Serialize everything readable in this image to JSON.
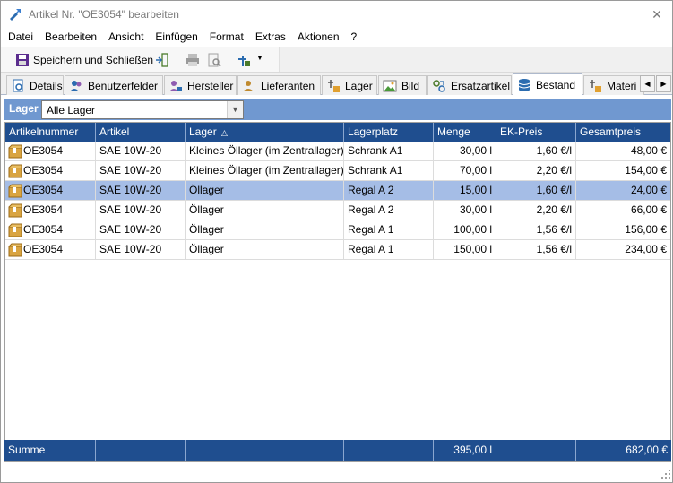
{
  "window": {
    "title": "Artikel Nr. \"OE3054\" bearbeiten",
    "close_icon": "close-icon"
  },
  "menu": [
    "Datei",
    "Bearbeiten",
    "Ansicht",
    "Einfügen",
    "Format",
    "Extras",
    "Aktionen",
    "?"
  ],
  "toolbar": {
    "save_label": "Speichern und Schließen"
  },
  "tabs": [
    {
      "label": "Details",
      "icon": "details-icon"
    },
    {
      "label": "Benutzerfelder",
      "icon": "users-icon"
    },
    {
      "label": "Hersteller",
      "icon": "manufacturer-icon"
    },
    {
      "label": "Lieferanten",
      "icon": "supplier-icon"
    },
    {
      "label": "Lager",
      "icon": "warehouse-icon"
    },
    {
      "label": "Bild",
      "icon": "image-icon"
    },
    {
      "label": "Ersatzartikel",
      "icon": "replacement-icon"
    },
    {
      "label": "Bestand",
      "icon": "stock-icon",
      "active": true
    },
    {
      "label": "Materi",
      "icon": "material-icon"
    }
  ],
  "filter": {
    "label": "Lager",
    "value": "Alle Lager"
  },
  "table": {
    "columns": [
      "Artikelnummer",
      "Artikel",
      "Lager",
      "Lagerplatz",
      "Menge",
      "EK-Preis",
      "Gesamtpreis"
    ],
    "sort_column": "Lager",
    "rows": [
      {
        "artikelnummer": "OE3054",
        "artikel": "SAE 10W-20",
        "lager": "Kleines Öllager (im Zentrallager)",
        "lagerplatz": "Schrank A1",
        "menge": "30,00 l",
        "ek_preis": "1,60 €/l",
        "gesamtpreis": "48,00 €",
        "selected": false
      },
      {
        "artikelnummer": "OE3054",
        "artikel": "SAE 10W-20",
        "lager": "Kleines Öllager (im Zentrallager)",
        "lagerplatz": "Schrank A1",
        "menge": "70,00 l",
        "ek_preis": "2,20 €/l",
        "gesamtpreis": "154,00 €",
        "selected": false
      },
      {
        "artikelnummer": "OE3054",
        "artikel": "SAE 10W-20",
        "lager": "Öllager",
        "lagerplatz": "Regal A 2",
        "menge": "15,00 l",
        "ek_preis": "1,60 €/l",
        "gesamtpreis": "24,00 €",
        "selected": true
      },
      {
        "artikelnummer": "OE3054",
        "artikel": "SAE 10W-20",
        "lager": "Öllager",
        "lagerplatz": "Regal A 2",
        "menge": "30,00 l",
        "ek_preis": "2,20 €/l",
        "gesamtpreis": "66,00 €",
        "selected": false
      },
      {
        "artikelnummer": "OE3054",
        "artikel": "SAE 10W-20",
        "lager": "Öllager",
        "lagerplatz": "Regal A 1",
        "menge": "100,00 l",
        "ek_preis": "1,56 €/l",
        "gesamtpreis": "156,00 €",
        "selected": false
      },
      {
        "artikelnummer": "OE3054",
        "artikel": "SAE 10W-20",
        "lager": "Öllager",
        "lagerplatz": "Regal A 1",
        "menge": "150,00 l",
        "ek_preis": "1,56 €/l",
        "gesamtpreis": "234,00 €",
        "selected": false
      }
    ],
    "footer": {
      "label": "Summe",
      "menge": "395,00 l",
      "gesamtpreis": "682,00 €"
    }
  },
  "colors": {
    "header_bg": "#1f4e8f",
    "filter_bg": "#7098d0",
    "selected_row": "#a5bde6"
  }
}
